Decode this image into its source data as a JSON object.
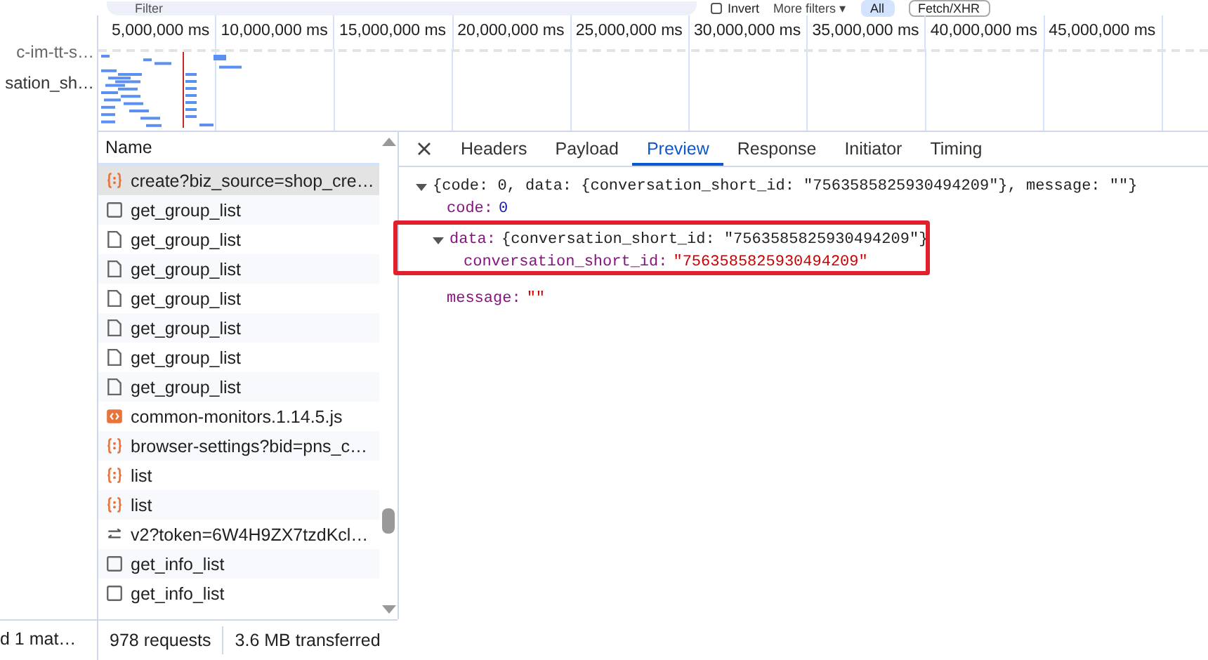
{
  "toolbar": {
    "filter_placeholder": "Filter",
    "invert": {
      "label": "Invert",
      "checked": false
    },
    "more_filters": "More filters ▾",
    "type_filters": [
      {
        "label": "All",
        "selected": true
      },
      {
        "label": "Fetch/XHR",
        "selected": false
      }
    ]
  },
  "left_names": [
    "c-im-tt-s…",
    "sation_sh…"
  ],
  "left_status": "d 1 mat…",
  "timeline": {
    "ticks": [
      "5,000,000 ms",
      "10,000,000 ms",
      "15,000,000 ms",
      "20,000,000 ms",
      "25,000,000 ms",
      "30,000,000 ms",
      "35,000,000 ms",
      "40,000,000 ms",
      "45,000,000 ms"
    ]
  },
  "requests": {
    "header": "Name",
    "rows": [
      {
        "name": "create?biz_source=shop_cre…",
        "kind": "fetch",
        "selected": true
      },
      {
        "name": "get_group_list",
        "kind": "blank",
        "selected": false
      },
      {
        "name": "get_group_list",
        "kind": "document",
        "selected": false
      },
      {
        "name": "get_group_list",
        "kind": "document",
        "selected": false
      },
      {
        "name": "get_group_list",
        "kind": "document",
        "selected": false
      },
      {
        "name": "get_group_list",
        "kind": "document",
        "selected": false
      },
      {
        "name": "get_group_list",
        "kind": "document",
        "selected": false
      },
      {
        "name": "get_group_list",
        "kind": "document",
        "selected": false
      },
      {
        "name": "common-monitors.1.14.5.js",
        "kind": "script",
        "selected": false
      },
      {
        "name": "browser-settings?bid=pns_c…",
        "kind": "fetch",
        "selected": false
      },
      {
        "name": "list",
        "kind": "fetch",
        "selected": false
      },
      {
        "name": "list",
        "kind": "fetch",
        "selected": false
      },
      {
        "name": "v2?token=6W4H9ZX7tzdKcl…",
        "kind": "socket",
        "selected": false
      },
      {
        "name": "get_info_list",
        "kind": "blank",
        "selected": false
      },
      {
        "name": "get_info_list",
        "kind": "blank",
        "selected": false
      }
    ]
  },
  "status_bar": [
    "978 requests",
    "3.6 MB transferred"
  ],
  "tabs": [
    {
      "label": "Headers",
      "selected": false
    },
    {
      "label": "Payload",
      "selected": false
    },
    {
      "label": "Preview",
      "selected": true
    },
    {
      "label": "Response",
      "selected": false
    },
    {
      "label": "Initiator",
      "selected": false
    },
    {
      "label": "Timing",
      "selected": false
    }
  ],
  "preview": {
    "summary": "{code: 0, data: {conversation_short_id: \"7563585825930494209\"}, message: \"\"}",
    "expanded": true,
    "children": [
      {
        "key": "code:",
        "value": "0",
        "kind": "number"
      },
      {
        "key": "data:",
        "summary": "{conversation_short_id: \"7563585825930494209\"}",
        "expanded": true,
        "highlighted": true,
        "children": [
          {
            "key": "conversation_short_id:",
            "value": "\"7563585825930494209\"",
            "kind": "string"
          }
        ]
      },
      {
        "key": "message:",
        "value": "\"\"",
        "kind": "string"
      }
    ]
  }
}
